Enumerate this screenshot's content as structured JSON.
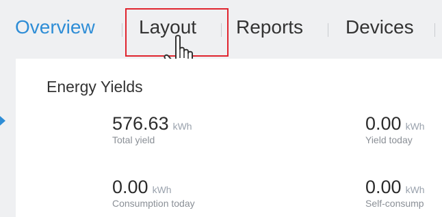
{
  "tabs": [
    {
      "label": "Overview"
    },
    {
      "label": "Layout"
    },
    {
      "label": "Reports"
    },
    {
      "label": "Devices"
    }
  ],
  "panel": {
    "title": "Energy Yields",
    "metrics": [
      {
        "value": "576.63",
        "unit": "kWh",
        "label": "Total yield"
      },
      {
        "value": "0.00",
        "unit": "kWh",
        "label": "Yield today"
      },
      {
        "value": "0.00",
        "unit": "kWh",
        "label": "Consumption today"
      },
      {
        "value": "0.00",
        "unit": "kWh",
        "label": "Self-consump"
      }
    ]
  },
  "colors": {
    "accent": "#2e8dd6",
    "highlight_border": "#e0232d"
  },
  "icons": [
    "hand-pointer-icon",
    "chevron-right-icon"
  ]
}
